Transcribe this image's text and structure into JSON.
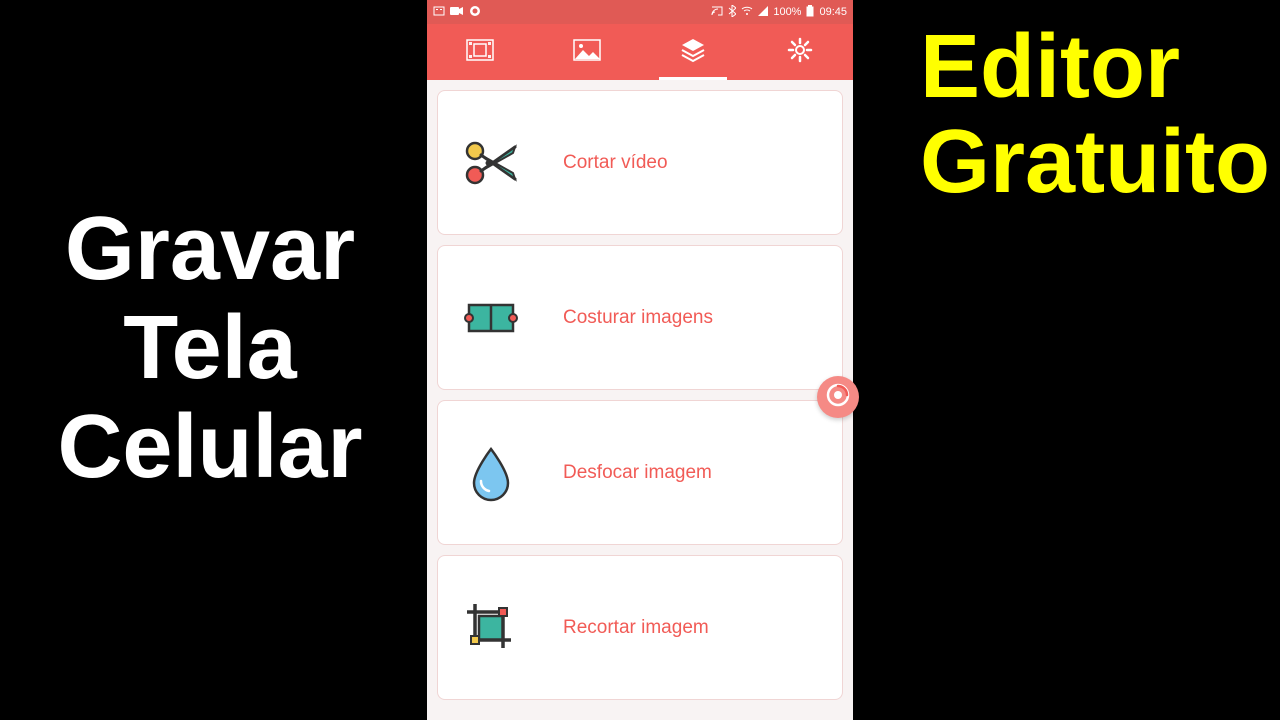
{
  "left_caption": {
    "line1": "Gravar",
    "line2": "Tela",
    "line3": "Celular"
  },
  "right_caption": {
    "line1": "Editor",
    "line2": "Gratuito"
  },
  "status_bar": {
    "battery": "100%",
    "time": "09:45"
  },
  "tabs": [
    {
      "name": "video",
      "active": false
    },
    {
      "name": "image",
      "active": false
    },
    {
      "name": "tools",
      "active": true
    },
    {
      "name": "settings",
      "active": false
    }
  ],
  "tools": [
    {
      "icon": "scissors",
      "label": "Cortar vídeo"
    },
    {
      "icon": "stitch",
      "label": "Costurar imagens"
    },
    {
      "icon": "blur",
      "label": "Desfocar imagem"
    },
    {
      "icon": "crop",
      "label": "Recortar imagem"
    }
  ],
  "colors": {
    "accent": "#f15b56",
    "accent_dark": "#e05a55",
    "teal": "#3cb5a0",
    "yellow_accent": "#f2c94c"
  }
}
